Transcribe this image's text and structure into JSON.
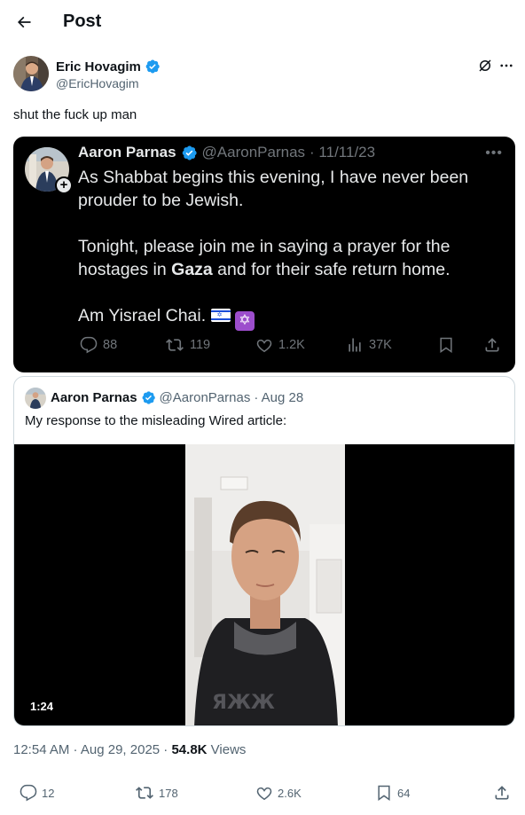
{
  "header": {
    "title": "Post"
  },
  "author": {
    "name": "Eric Hovagim",
    "handle": "@EricHovagim"
  },
  "post": {
    "text": "shut the fuck up man"
  },
  "screenshot": {
    "name": "Aaron Parnas",
    "handle": "@AaronParnas",
    "date": "· 11/11/23",
    "line1": "As Shabbat begins this evening, I have never been prouder to be Jewish.",
    "line2_pre": "Tonight, please join me in saying a prayer for the hostages in ",
    "line2_bold": "Gaza",
    "line2_post": " and for their safe return home.",
    "line3": "Am Yisrael Chai.",
    "replies": "88",
    "reposts": "119",
    "likes": "1.2K",
    "views": "37K"
  },
  "quote": {
    "name": "Aaron Parnas",
    "handle": "@AaronParnas",
    "date": "· Aug 28",
    "text": "My response to the misleading Wired article:",
    "video_duration": "1:24"
  },
  "meta": {
    "time": "12:54 AM · Aug 29, 2025 ·",
    "views_count": "54.8K",
    "views_label": "Views"
  },
  "actions": {
    "replies": "12",
    "reposts": "178",
    "likes": "2.6K",
    "bookmarks": "64"
  },
  "colors": {
    "verified": "#1d9bf0",
    "text": "#0f1419",
    "secondary": "#536471"
  }
}
